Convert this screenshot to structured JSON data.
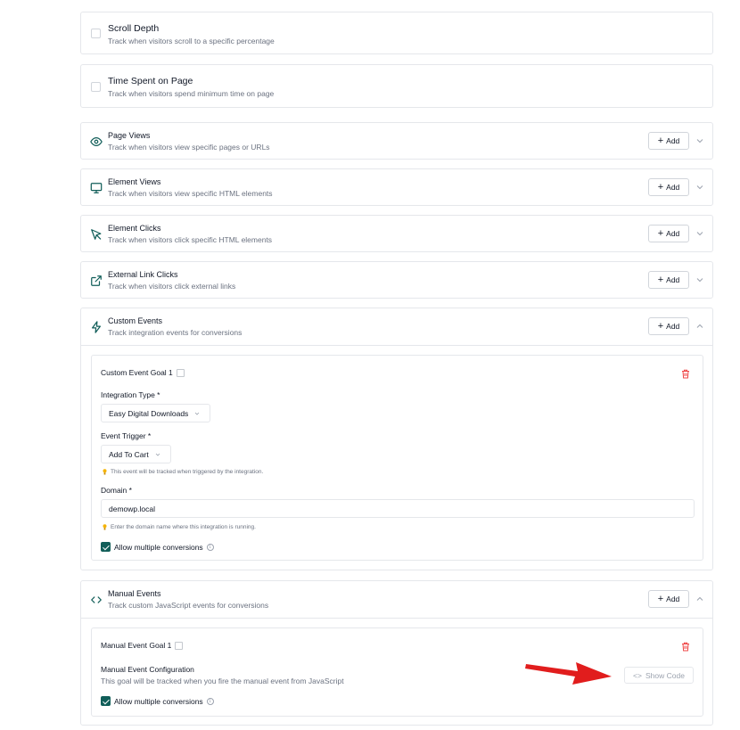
{
  "simple_goals": [
    {
      "title": "Scroll Depth",
      "description": "Track when visitors scroll to a specific percentage"
    },
    {
      "title": "Time Spent on Page",
      "description": "Track when visitors spend minimum time on page"
    }
  ],
  "goal_types": [
    {
      "title": "Page Views",
      "description": "Track when visitors view specific pages or URLs",
      "icon": "eye-icon",
      "add_label": "Add"
    },
    {
      "title": "Element Views",
      "description": "Track when visitors view specific HTML elements",
      "icon": "monitor-icon",
      "add_label": "Add"
    },
    {
      "title": "Element Clicks",
      "description": "Track when visitors click specific HTML elements",
      "icon": "cursor-click-icon",
      "add_label": "Add"
    },
    {
      "title": "External Link Clicks",
      "description": "Track when visitors click external links",
      "icon": "external-link-icon",
      "add_label": "Add"
    }
  ],
  "custom_events": {
    "title": "Custom Events",
    "description": "Track integration events for conversions",
    "add_label": "Add",
    "goal": {
      "name": "Custom Event Goal 1",
      "integration_type_label": "Integration Type *",
      "integration_type_value": "Easy Digital Downloads",
      "event_trigger_label": "Event Trigger *",
      "event_trigger_value": "Add To Cart",
      "event_trigger_hint": "This event will be tracked when triggered by the integration.",
      "domain_label": "Domain *",
      "domain_value": "demowp.local",
      "domain_hint": "Enter the domain name where this integration is running.",
      "allow_multiple_label": "Allow multiple conversions",
      "allow_multiple_checked": true
    }
  },
  "manual_events": {
    "title": "Manual Events",
    "description": "Track custom JavaScript events for conversions",
    "add_label": "Add",
    "goal": {
      "name": "Manual Event Goal 1",
      "config_label": "Manual Event Configuration",
      "config_description": "This goal will be tracked when you fire the manual event from JavaScript",
      "show_code_label": "Show Code",
      "allow_multiple_label": "Allow multiple conversions",
      "allow_multiple_checked": true
    }
  },
  "colors": {
    "accent": "#115e59",
    "danger": "#ef4444",
    "annotation_arrow": "#e11d1d"
  }
}
